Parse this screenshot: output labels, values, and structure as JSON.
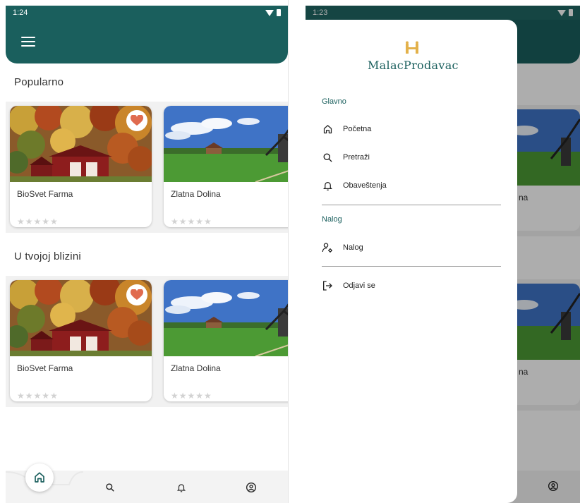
{
  "left_screen": {
    "status": {
      "time": "1:24"
    },
    "sections": [
      {
        "title": "Popularno",
        "cards": [
          {
            "name": "BioSvet Farma",
            "rating": "★★★★★",
            "favorited": true
          },
          {
            "name": "Zlatna Dolina",
            "rating": "★★★★★",
            "favorited": true
          }
        ]
      },
      {
        "title": "U tvojoj blizini",
        "cards": [
          {
            "name": "BioSvet Farma",
            "rating": "★★★★★",
            "favorited": true
          },
          {
            "name": "Zlatna Dolina",
            "rating": "★★★★★",
            "favorited": true
          }
        ]
      }
    ],
    "bottom_nav": {
      "active": "home",
      "items": [
        "home-icon",
        "search-icon",
        "bell-icon",
        "profile-icon"
      ]
    }
  },
  "right_screen": {
    "status": {
      "time": "1:23"
    },
    "drawer": {
      "logo_text": "MalacProdavac",
      "groups": [
        {
          "label": "Glavno",
          "items": [
            {
              "label": "Početna",
              "icon": "home-icon"
            },
            {
              "label": "Pretraži",
              "icon": "search-icon"
            },
            {
              "label": "Obaveštenja",
              "icon": "bell-icon"
            }
          ]
        },
        {
          "label": "Nalog",
          "items": [
            {
              "label": "Nalog",
              "icon": "account-settings-icon"
            }
          ]
        }
      ],
      "logout": {
        "label": "Odjavi se",
        "icon": "logout-icon"
      }
    },
    "background_peek": {
      "card_text_1": "na",
      "card_text_2": "na"
    }
  },
  "colors": {
    "primary": "#1a5f5d",
    "heart": "#e06b4f",
    "accent_logo": "#e3b14a"
  }
}
